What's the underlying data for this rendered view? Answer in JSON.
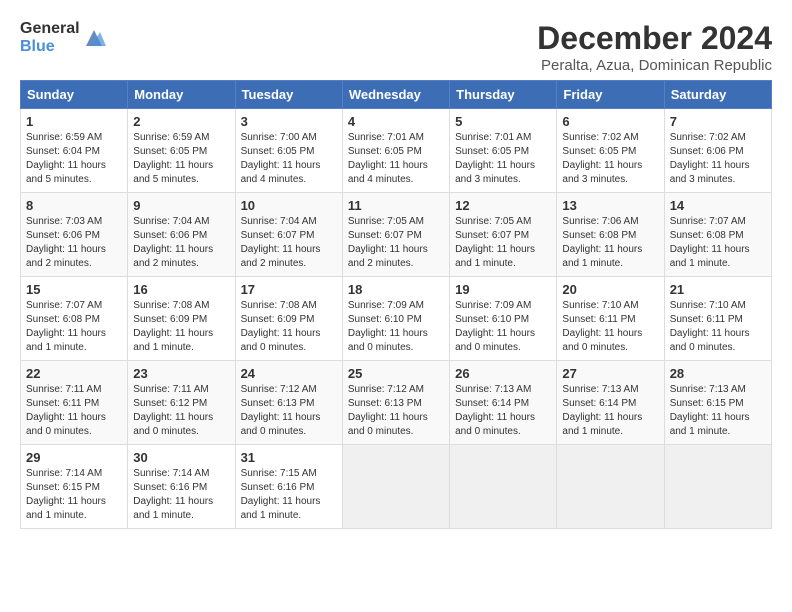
{
  "logo": {
    "general": "General",
    "blue": "Blue"
  },
  "title": {
    "month": "December 2024",
    "location": "Peralta, Azua, Dominican Republic"
  },
  "weekdays": [
    "Sunday",
    "Monday",
    "Tuesday",
    "Wednesday",
    "Thursday",
    "Friday",
    "Saturday"
  ],
  "weeks": [
    [
      {
        "day": "1",
        "info": "Sunrise: 6:59 AM\nSunset: 6:04 PM\nDaylight: 11 hours\nand 5 minutes."
      },
      {
        "day": "2",
        "info": "Sunrise: 6:59 AM\nSunset: 6:05 PM\nDaylight: 11 hours\nand 5 minutes."
      },
      {
        "day": "3",
        "info": "Sunrise: 7:00 AM\nSunset: 6:05 PM\nDaylight: 11 hours\nand 4 minutes."
      },
      {
        "day": "4",
        "info": "Sunrise: 7:01 AM\nSunset: 6:05 PM\nDaylight: 11 hours\nand 4 minutes."
      },
      {
        "day": "5",
        "info": "Sunrise: 7:01 AM\nSunset: 6:05 PM\nDaylight: 11 hours\nand 3 minutes."
      },
      {
        "day": "6",
        "info": "Sunrise: 7:02 AM\nSunset: 6:05 PM\nDaylight: 11 hours\nand 3 minutes."
      },
      {
        "day": "7",
        "info": "Sunrise: 7:02 AM\nSunset: 6:06 PM\nDaylight: 11 hours\nand 3 minutes."
      }
    ],
    [
      {
        "day": "8",
        "info": "Sunrise: 7:03 AM\nSunset: 6:06 PM\nDaylight: 11 hours\nand 2 minutes."
      },
      {
        "day": "9",
        "info": "Sunrise: 7:04 AM\nSunset: 6:06 PM\nDaylight: 11 hours\nand 2 minutes."
      },
      {
        "day": "10",
        "info": "Sunrise: 7:04 AM\nSunset: 6:07 PM\nDaylight: 11 hours\nand 2 minutes."
      },
      {
        "day": "11",
        "info": "Sunrise: 7:05 AM\nSunset: 6:07 PM\nDaylight: 11 hours\nand 2 minutes."
      },
      {
        "day": "12",
        "info": "Sunrise: 7:05 AM\nSunset: 6:07 PM\nDaylight: 11 hours\nand 1 minute."
      },
      {
        "day": "13",
        "info": "Sunrise: 7:06 AM\nSunset: 6:08 PM\nDaylight: 11 hours\nand 1 minute."
      },
      {
        "day": "14",
        "info": "Sunrise: 7:07 AM\nSunset: 6:08 PM\nDaylight: 11 hours\nand 1 minute."
      }
    ],
    [
      {
        "day": "15",
        "info": "Sunrise: 7:07 AM\nSunset: 6:08 PM\nDaylight: 11 hours\nand 1 minute."
      },
      {
        "day": "16",
        "info": "Sunrise: 7:08 AM\nSunset: 6:09 PM\nDaylight: 11 hours\nand 1 minute."
      },
      {
        "day": "17",
        "info": "Sunrise: 7:08 AM\nSunset: 6:09 PM\nDaylight: 11 hours\nand 0 minutes."
      },
      {
        "day": "18",
        "info": "Sunrise: 7:09 AM\nSunset: 6:10 PM\nDaylight: 11 hours\nand 0 minutes."
      },
      {
        "day": "19",
        "info": "Sunrise: 7:09 AM\nSunset: 6:10 PM\nDaylight: 11 hours\nand 0 minutes."
      },
      {
        "day": "20",
        "info": "Sunrise: 7:10 AM\nSunset: 6:11 PM\nDaylight: 11 hours\nand 0 minutes."
      },
      {
        "day": "21",
        "info": "Sunrise: 7:10 AM\nSunset: 6:11 PM\nDaylight: 11 hours\nand 0 minutes."
      }
    ],
    [
      {
        "day": "22",
        "info": "Sunrise: 7:11 AM\nSunset: 6:11 PM\nDaylight: 11 hours\nand 0 minutes."
      },
      {
        "day": "23",
        "info": "Sunrise: 7:11 AM\nSunset: 6:12 PM\nDaylight: 11 hours\nand 0 minutes."
      },
      {
        "day": "24",
        "info": "Sunrise: 7:12 AM\nSunset: 6:13 PM\nDaylight: 11 hours\nand 0 minutes."
      },
      {
        "day": "25",
        "info": "Sunrise: 7:12 AM\nSunset: 6:13 PM\nDaylight: 11 hours\nand 0 minutes."
      },
      {
        "day": "26",
        "info": "Sunrise: 7:13 AM\nSunset: 6:14 PM\nDaylight: 11 hours\nand 0 minutes."
      },
      {
        "day": "27",
        "info": "Sunrise: 7:13 AM\nSunset: 6:14 PM\nDaylight: 11 hours\nand 1 minute."
      },
      {
        "day": "28",
        "info": "Sunrise: 7:13 AM\nSunset: 6:15 PM\nDaylight: 11 hours\nand 1 minute."
      }
    ],
    [
      {
        "day": "29",
        "info": "Sunrise: 7:14 AM\nSunset: 6:15 PM\nDaylight: 11 hours\nand 1 minute."
      },
      {
        "day": "30",
        "info": "Sunrise: 7:14 AM\nSunset: 6:16 PM\nDaylight: 11 hours\nand 1 minute."
      },
      {
        "day": "31",
        "info": "Sunrise: 7:15 AM\nSunset: 6:16 PM\nDaylight: 11 hours\nand 1 minute."
      },
      {
        "day": "",
        "info": ""
      },
      {
        "day": "",
        "info": ""
      },
      {
        "day": "",
        "info": ""
      },
      {
        "day": "",
        "info": ""
      }
    ]
  ]
}
